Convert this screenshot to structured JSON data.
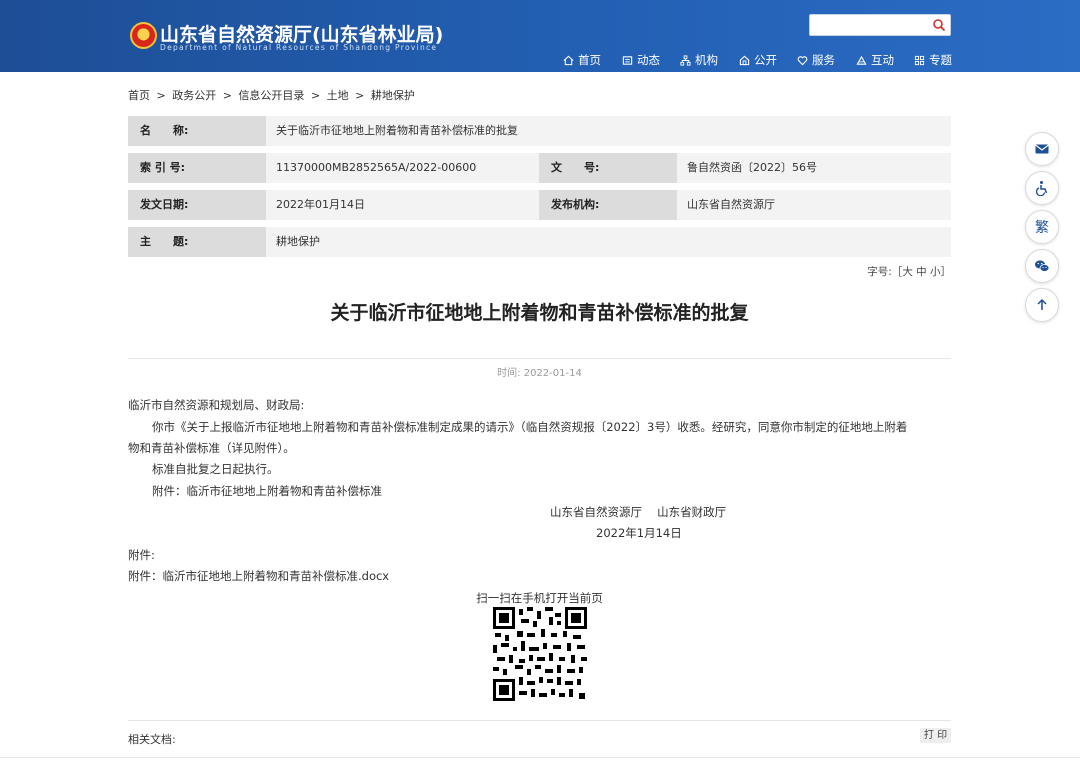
{
  "header": {
    "site_title": "山东省自然资源厅(山东省林业局)",
    "site_subtitle": "Department of Natural Resources of Shandong Province",
    "search_placeholder": "",
    "nav": [
      {
        "label": "首页",
        "icon": "home-icon"
      },
      {
        "label": "动态",
        "icon": "news-icon"
      },
      {
        "label": "机构",
        "icon": "org-icon"
      },
      {
        "label": "公开",
        "icon": "open-icon"
      },
      {
        "label": "服务",
        "icon": "heart-icon"
      },
      {
        "label": "互动",
        "icon": "interact-icon"
      },
      {
        "label": "专题",
        "icon": "grid-icon"
      }
    ]
  },
  "breadcrumb": [
    "首页",
    ">",
    "政务公开",
    ">",
    "信息公开目录",
    ">",
    "土地",
    ">",
    "耕地保护"
  ],
  "meta": {
    "name_label": "名　　称:",
    "name_value": "关于临沂市征地地上附着物和青苗补偿标准的批复",
    "index_label": "索 引 号:",
    "index_value": "11370000MB2852565A/2022-00600",
    "docno_label": "文　　号:",
    "docno_value": "鲁自然资函〔2022〕56号",
    "date_label": "发文日期:",
    "date_value": "2022年01月14日",
    "org_label": "发布机构:",
    "org_value": "山东省自然资源厅",
    "topic_label": "主　　题:",
    "topic_value": "耕地保护"
  },
  "font_size": {
    "prefix": "字号:［",
    "large": "大",
    "medium": "中",
    "small": "小",
    "suffix": "］"
  },
  "article": {
    "title": "关于临沂市征地地上附着物和青苗补偿标准的批复",
    "time_label": "时间:",
    "time_value": "2022-01-14",
    "salutation": "临沂市自然资源和规划局、财政局:",
    "body_line1": "你市《关于上报临沂市征地地上附着物和青苗补偿标准制定成果的请示》（临自然资规报〔2022〕3号）收悉。经研究，同意你市制定的征地地上附着",
    "body_line2": "物和青苗补偿标准（详见附件）。",
    "body_line3": "标准自批复之日起执行。",
    "body_line4": "附件：临沂市征地地上附着物和青苗补偿标准",
    "signature": "山东省自然资源厅　 山东省财政厅",
    "sign_date": "2022年1月14日",
    "attach_label": "附件:",
    "attach_file": "附件：临沂市征地地上附着物和青苗补偿标准.docx"
  },
  "qr_caption": "扫一扫在手机打开当前页",
  "related_label": "相关文档:",
  "print_label": "打 印",
  "side_tools": [
    {
      "icon": "mail-icon"
    },
    {
      "icon": "accessibility-icon"
    },
    {
      "label": "繁",
      "icon": "traditional-chinese-icon"
    },
    {
      "icon": "wechat-icon"
    },
    {
      "icon": "back-to-top-icon"
    }
  ]
}
